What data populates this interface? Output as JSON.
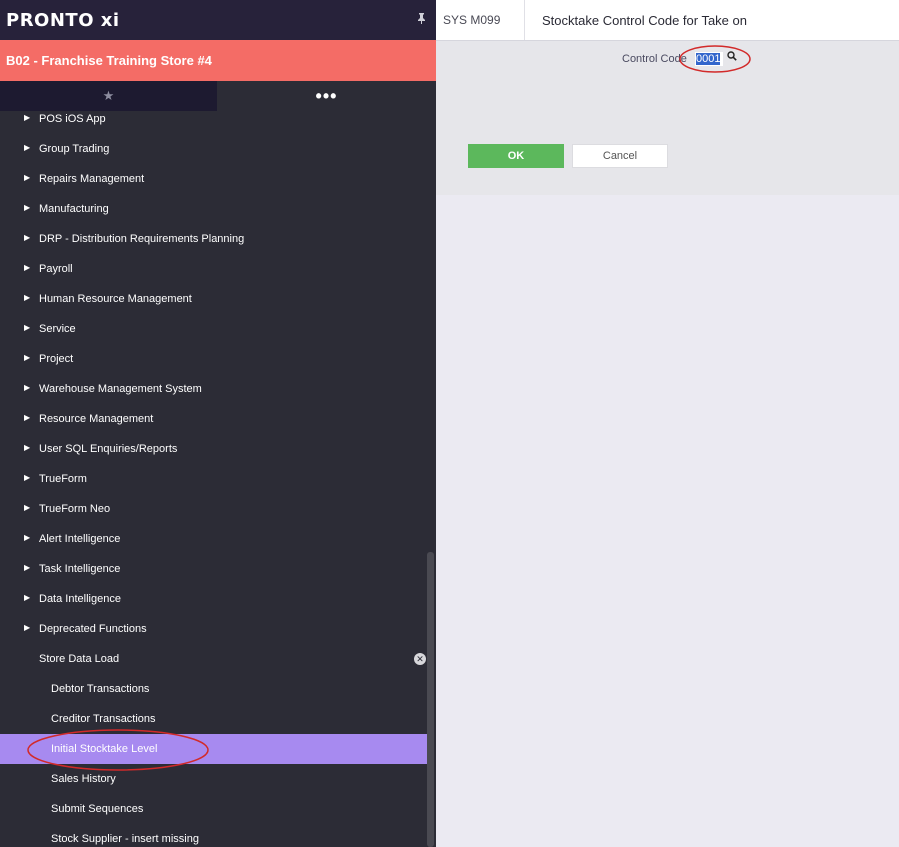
{
  "sidebar": {
    "brand": "PRONTO xi",
    "store": "B02 - Franchise Training Store #4",
    "tabs": {
      "favorites": "★",
      "more": "•••"
    },
    "items": [
      {
        "label": "POS iOS App"
      },
      {
        "label": "Group Trading"
      },
      {
        "label": "Repairs Management"
      },
      {
        "label": "Manufacturing"
      },
      {
        "label": "DRP - Distribution Requirements Planning"
      },
      {
        "label": "Payroll"
      },
      {
        "label": "Human Resource Management"
      },
      {
        "label": "Service"
      },
      {
        "label": "Project"
      },
      {
        "label": "Warehouse Management System"
      },
      {
        "label": "Resource Management"
      },
      {
        "label": "User SQL Enquiries/Reports"
      },
      {
        "label": "TrueForm"
      },
      {
        "label": "TrueForm Neo"
      },
      {
        "label": "Alert Intelligence"
      },
      {
        "label": "Task Intelligence"
      },
      {
        "label": "Data Intelligence"
      },
      {
        "label": "Deprecated Functions"
      }
    ],
    "expanded": {
      "label": "Store Data Load",
      "children": [
        {
          "label": "Debtor Transactions"
        },
        {
          "label": "Creditor Transactions"
        },
        {
          "label": "Initial Stocktake Level"
        },
        {
          "label": "Sales History"
        },
        {
          "label": "Submit Sequences"
        },
        {
          "label": "Stock Supplier - insert missing"
        }
      ]
    }
  },
  "header": {
    "program_code": "SYS M099",
    "title": "Stocktake Control Code for Take on"
  },
  "form": {
    "control_code_label": "Control Code",
    "control_code_value": "0001",
    "ok_label": "OK",
    "cancel_label": "Cancel"
  },
  "colors": {
    "brand_bar": "#27223a",
    "store_bar": "#f46c66",
    "sidebar_bg": "#2c2c36",
    "active_item": "#a78af0",
    "ok_button": "#5cb85c",
    "annotation": "#d22a2a"
  }
}
